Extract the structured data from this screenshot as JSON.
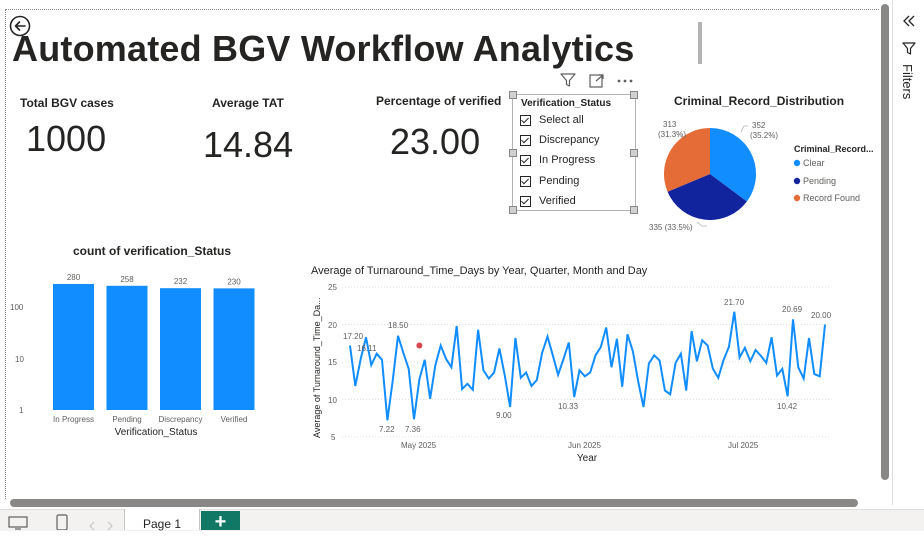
{
  "report": {
    "title": "Automated BGV Workflow Analytics"
  },
  "kpis": [
    {
      "label": "Total BGV cases",
      "value": "1000"
    },
    {
      "label": "Average TAT",
      "value": "14.84"
    },
    {
      "label": "Percentage of verified",
      "value": "23.00"
    }
  ],
  "slicer": {
    "title": "Verification_Status",
    "items": [
      "Select all",
      "Discrepancy",
      "In Progress",
      "Pending",
      "Verified"
    ]
  },
  "pie": {
    "title": "Criminal_Record_Distribution",
    "legend_title": "Criminal_Record...",
    "slices": [
      {
        "name": "Clear",
        "value": 352,
        "label": "352",
        "pct": "(35.2%)",
        "color": "#118DFF"
      },
      {
        "name": "Pending",
        "value": 335,
        "label": "335 (33.5%)",
        "pct": "",
        "color": "#12239E"
      },
      {
        "name": "Record Found",
        "value": 313,
        "label": "313",
        "pct": "(31.3%)",
        "color": "#E66C37"
      }
    ]
  },
  "bar": {
    "title": "count of verification_Status",
    "xlabel": "Verification_Status",
    "categories": [
      "In Progress",
      "Pending",
      "Discrepancy",
      "Verified"
    ],
    "values": [
      280,
      258,
      232,
      230
    ],
    "y_ticks": [
      "100",
      "10",
      "1"
    ],
    "scale": "log",
    "color": "#118DFF"
  },
  "line": {
    "title": "Average of Turnaround_Time_Days by Year, Quarter, Month and Day",
    "xlabel": "Year",
    "ylabel": "Average of Turnaround_Time_Da...",
    "y_ticks": [
      "25",
      "20",
      "15",
      "10",
      "5"
    ],
    "x_ticks": [
      "May 2025",
      "Jun 2025",
      "Jul 2025"
    ],
    "annotations": [
      "17.20",
      "18.50",
      "16.11",
      "7.22",
      "7.36",
      "9.00",
      "10.33",
      "21.70",
      "20.69",
      "20.00",
      "10.42"
    ],
    "color": "#118DFF",
    "highlight_color": "#D64550"
  },
  "chart_data": {
    "type": "line",
    "title": "Average of Turnaround_Time_Days by Year, Quarter, Month and Day",
    "xlabel": "Year",
    "ylabel": "Average of Turnaround_Time_Da...",
    "ylim": [
      5,
      25
    ],
    "x": [
      "2025-04-16",
      "2025-04-17",
      "2025-04-18",
      "2025-04-19",
      "2025-04-20",
      "2025-04-21",
      "2025-04-22",
      "2025-04-23",
      "2025-04-24",
      "2025-04-25",
      "2025-04-26",
      "2025-04-27",
      "2025-04-28",
      "2025-04-29",
      "2025-04-30",
      "2025-05-01",
      "2025-05-02",
      "2025-05-03",
      "2025-05-04",
      "2025-05-05",
      "2025-05-06",
      "2025-05-07",
      "2025-05-08",
      "2025-05-09",
      "2025-05-10",
      "2025-05-11",
      "2025-05-12",
      "2025-05-13",
      "2025-05-14",
      "2025-05-15",
      "2025-05-16",
      "2025-05-17",
      "2025-05-18",
      "2025-05-19",
      "2025-05-20",
      "2025-05-21",
      "2025-05-22",
      "2025-05-23",
      "2025-05-24",
      "2025-05-25",
      "2025-05-26",
      "2025-05-27",
      "2025-05-28",
      "2025-05-29",
      "2025-05-30",
      "2025-05-31",
      "2025-06-01",
      "2025-06-02",
      "2025-06-03",
      "2025-06-04",
      "2025-06-05",
      "2025-06-06",
      "2025-06-07",
      "2025-06-08",
      "2025-06-09",
      "2025-06-10",
      "2025-06-11",
      "2025-06-12",
      "2025-06-13",
      "2025-06-14",
      "2025-06-15",
      "2025-06-16",
      "2025-06-17",
      "2025-06-18",
      "2025-06-19",
      "2025-06-20",
      "2025-06-21",
      "2025-06-22",
      "2025-06-23",
      "2025-06-24",
      "2025-06-25",
      "2025-06-26",
      "2025-06-27",
      "2025-06-28",
      "2025-06-29",
      "2025-06-30",
      "2025-07-01",
      "2025-07-02",
      "2025-07-03",
      "2025-07-04",
      "2025-07-05",
      "2025-07-06",
      "2025-07-07",
      "2025-07-08",
      "2025-07-09",
      "2025-07-10",
      "2025-07-11",
      "2025-07-12",
      "2025-07-13",
      "2025-07-14",
      "2025-07-15",
      "2025-07-16"
    ],
    "values": [
      17.2,
      11.8,
      15.4,
      18.3,
      14.6,
      16.1,
      15.3,
      7.22,
      12.5,
      18.5,
      16.2,
      14.1,
      7.36,
      12.7,
      15.3,
      10.1,
      14.6,
      17.2,
      15.4,
      14.3,
      19.8,
      11.4,
      12.1,
      11.3,
      19.3,
      13.9,
      12.8,
      13.6,
      16.8,
      13.2,
      9.0,
      18.2,
      12.9,
      13.6,
      11.8,
      12.6,
      16.2,
      18.4,
      15.9,
      13.3,
      15.4,
      17.6,
      10.33,
      13.9,
      13.1,
      13.6,
      15.9,
      17.0,
      19.6,
      14.3,
      18.1,
      11.7,
      18.7,
      16.4,
      12.4,
      9.0,
      14.8,
      15.9,
      15.2,
      11.2,
      10.7,
      14.9,
      16.1,
      11.2,
      19.1,
      15.1,
      17.9,
      17.2,
      14.1,
      12.9,
      15.3,
      17.0,
      21.7,
      15.6,
      16.9,
      15.1,
      16.6,
      15.8,
      14.9,
      18.3,
      13.2,
      14.1,
      10.42,
      20.69,
      14.3,
      12.8,
      18.2,
      13.4,
      13.1,
      20.0
    ],
    "highlight": {
      "x": "2025-04-29",
      "y": 17.2
    }
  }
}
